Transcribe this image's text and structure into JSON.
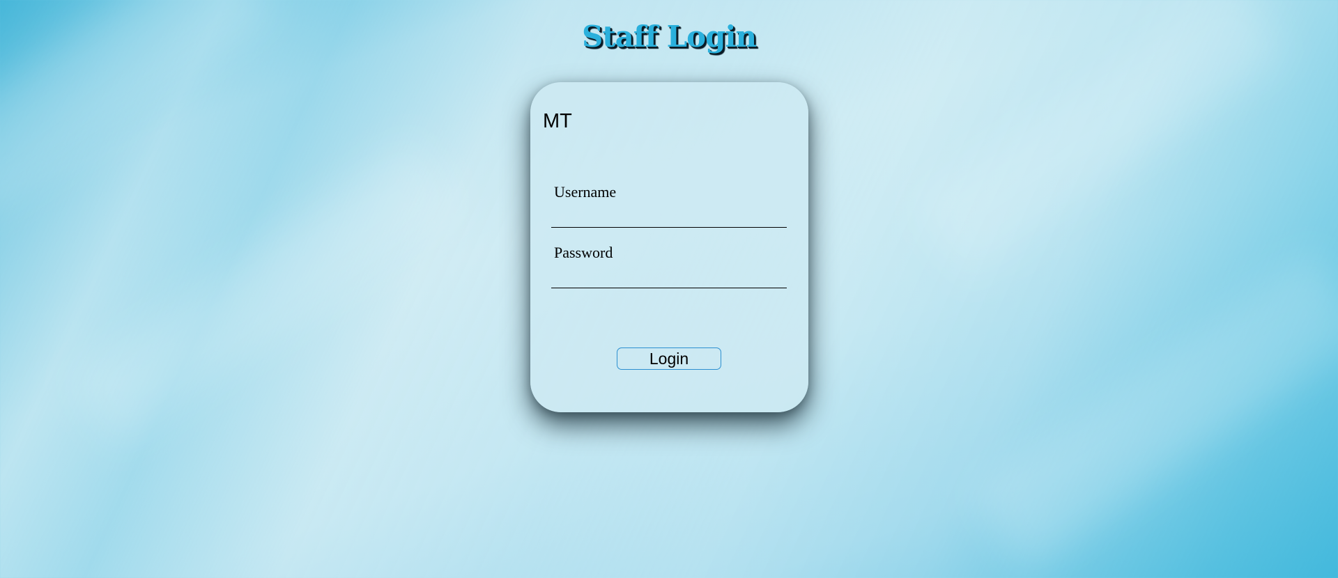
{
  "page": {
    "title": "Staff Login"
  },
  "card": {
    "logo": "MT",
    "username": {
      "label": "Username",
      "value": "",
      "placeholder": ""
    },
    "password": {
      "label": "Password",
      "value": "",
      "placeholder": ""
    },
    "login_button": "Login"
  },
  "colors": {
    "title_text": "#2ab0dc",
    "title_shadow": "#0a1a24",
    "button_border": "#2b8fd0",
    "card_background": "#cde9f2"
  }
}
